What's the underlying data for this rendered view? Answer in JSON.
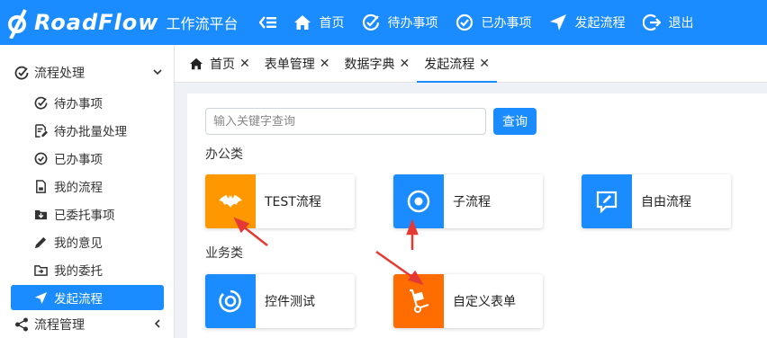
{
  "header": {
    "logo_text": "RoadFlow",
    "subtitle": "工作流平台",
    "nav": [
      {
        "label": "首页",
        "icon": "home-icon"
      },
      {
        "label": "待办事项",
        "icon": "check-circle-icon"
      },
      {
        "label": "已办事项",
        "icon": "check-circle-icon"
      },
      {
        "label": "发起流程",
        "icon": "send-icon"
      },
      {
        "label": "退出",
        "icon": "logout-icon"
      }
    ],
    "bg_color": "#1a8cff"
  },
  "sidebar": {
    "group": "流程处理",
    "items": [
      {
        "label": "待办事项",
        "icon": "check-circle-icon"
      },
      {
        "label": "待办批量处理",
        "icon": "batch-edit-icon"
      },
      {
        "label": "已办事项",
        "icon": "check-circle-icon"
      },
      {
        "label": "我的流程",
        "icon": "document-icon"
      },
      {
        "label": "已委托事项",
        "icon": "folder-download-icon"
      },
      {
        "label": "我的意见",
        "icon": "pencil-icon"
      },
      {
        "label": "我的委托",
        "icon": "folder-upload-icon"
      },
      {
        "label": "发起流程",
        "icon": "send-icon",
        "active": true
      }
    ],
    "group2": "流程管理"
  },
  "tabs": [
    {
      "label": "首页"
    },
    {
      "label": "表单管理"
    },
    {
      "label": "数据字典"
    },
    {
      "label": "发起流程",
      "active": true
    }
  ],
  "search": {
    "placeholder": "输入关键字查询",
    "button": "查询"
  },
  "categories": [
    {
      "title": "办公类",
      "flows": [
        {
          "name": "TEST流程",
          "icon": "bat-icon",
          "color": "#ff9800"
        },
        {
          "name": "子流程",
          "icon": "target-icon",
          "color": "#1a8cff"
        },
        {
          "name": "自由流程",
          "icon": "edit-bubble-icon",
          "color": "#1a8cff"
        }
      ]
    },
    {
      "title": "业务类",
      "flows": [
        {
          "name": "控件测试",
          "icon": "ring-icon",
          "color": "#1a8cff"
        },
        {
          "name": "自定义表单",
          "icon": "hand-truck-icon",
          "color": "#ff6d00"
        }
      ]
    }
  ],
  "annotation_color": "#e53935"
}
